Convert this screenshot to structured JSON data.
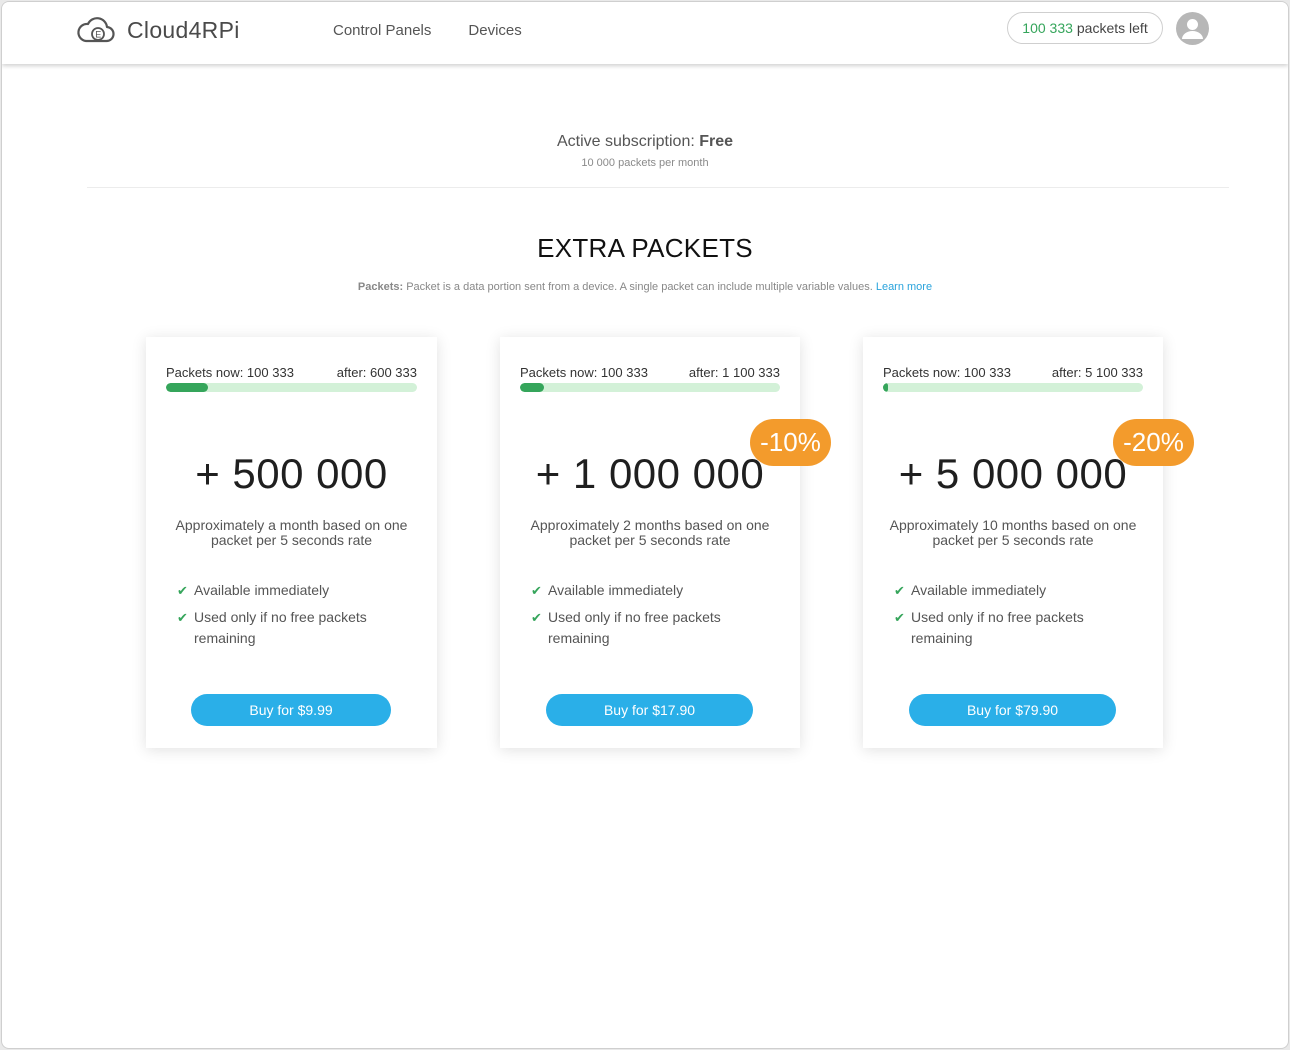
{
  "app": {
    "logo_text": "Cloud4RPi",
    "nav": [
      "Control Panels",
      "Devices"
    ],
    "packets_left_count": "100 333",
    "packets_left_label": "packets left"
  },
  "subscription": {
    "label": "Active subscription:",
    "plan": "Free",
    "detail": "10 000 packets per month"
  },
  "section": {
    "title": "EXTRA PACKETS",
    "note_label": "Packets:",
    "note_text": "Packet is a data portion sent from a device. A single packet can include multiple variable values.",
    "note_link": "Learn more"
  },
  "cards": [
    {
      "now": "Packets now: 100 333",
      "after": "after: 600 333",
      "progress": 0.167,
      "amount": "+ 500 000",
      "desc": "Approximately a month based on one packet per 5 seconds rate",
      "features": [
        "Available immediately",
        "Used only if no free packets remaining"
      ],
      "button": "Buy for $9.99",
      "discount": ""
    },
    {
      "now": "Packets now: 100 333",
      "after": "after: 1 100 333",
      "progress": 0.091,
      "amount": "+ 1 000 000",
      "desc": "Approximately 2 months based on one packet per 5 seconds rate",
      "features": [
        "Available immediately",
        "Used only if no free packets remaining"
      ],
      "button": "Buy for $17.90",
      "discount": "-10%"
    },
    {
      "now": "Packets now: 100 333",
      "after": "after: 5 100 333",
      "progress": 0.02,
      "amount": "+ 5 000 000",
      "desc": "Approximately 10 months based on one packet per 5 seconds rate",
      "features": [
        "Available immediately",
        "Used only if no free packets remaining"
      ],
      "button": "Buy for $79.90",
      "discount": "-20%"
    }
  ],
  "colors": {
    "accent_blue": "#2aafe8",
    "green": "#35a55b",
    "badge_orange": "#f39b2c",
    "progress_track": "#d3f1d8"
  },
  "icons": [
    "cloud-logo-icon",
    "user-avatar-icon",
    "checkmark-icon"
  ]
}
